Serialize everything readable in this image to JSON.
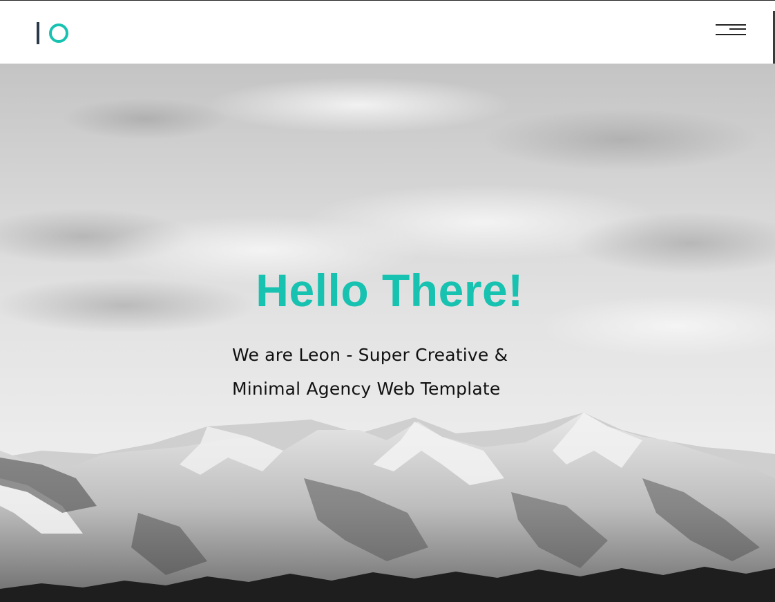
{
  "brand": {
    "logo_text": "IO",
    "accent_color": "#17c2b0",
    "dark_color": "#2b3a4a"
  },
  "header": {
    "menu_icon": "hamburger-menu-icon"
  },
  "hero": {
    "title": "Hello There!",
    "subtitle_line1": "We are Leon - Super Creative &",
    "subtitle_line2": "Minimal Agency Web Template",
    "background": "grayscale-mountain-landscape"
  }
}
